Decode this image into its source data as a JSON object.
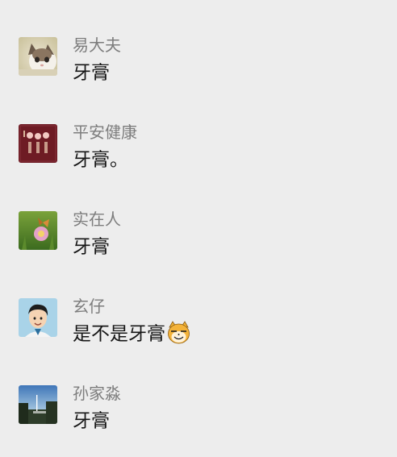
{
  "messages": [
    {
      "sender": "易大夫",
      "text": "牙膏",
      "avatar": "cat-photo-avatar"
    },
    {
      "sender": "平安健康",
      "text": "牙膏。",
      "avatar": "red-calligraphy-avatar"
    },
    {
      "sender": "实在人",
      "text": "牙膏",
      "avatar": "flower-butterfly-avatar"
    },
    {
      "sender": "玄仔",
      "text": "是不是牙膏",
      "avatar": "cartoon-man-avatar",
      "emoji": "grin-emoji"
    },
    {
      "sender": "孙家淼",
      "text": "牙膏",
      "avatar": "landscape-avatar"
    }
  ],
  "colors": {
    "background": "#ededed",
    "sender_name": "#7d7d7d",
    "message_text": "#161616"
  }
}
